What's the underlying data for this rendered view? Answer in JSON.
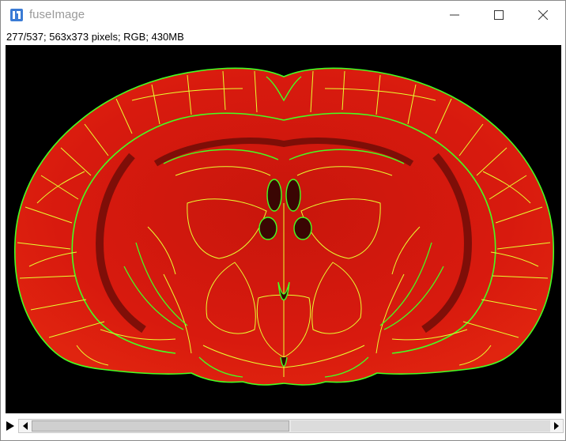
{
  "window": {
    "title": "fuseImage",
    "icon": "imagej-icon"
  },
  "controls": {
    "minimize": "minimize-icon",
    "maximize": "maximize-icon",
    "close": "close-icon"
  },
  "info": {
    "text": "277/537; 563x373 pixels; RGB; 430MB"
  },
  "image": {
    "description_colors": {
      "tissue": "#d81a0e",
      "tissue_dark": "#7a0c06",
      "outline_green": "#44ff22",
      "outline_yellow": "#e8ff30",
      "background": "#000000"
    }
  },
  "slider": {
    "current": 277,
    "total": 537,
    "position_fraction": 0.516
  }
}
